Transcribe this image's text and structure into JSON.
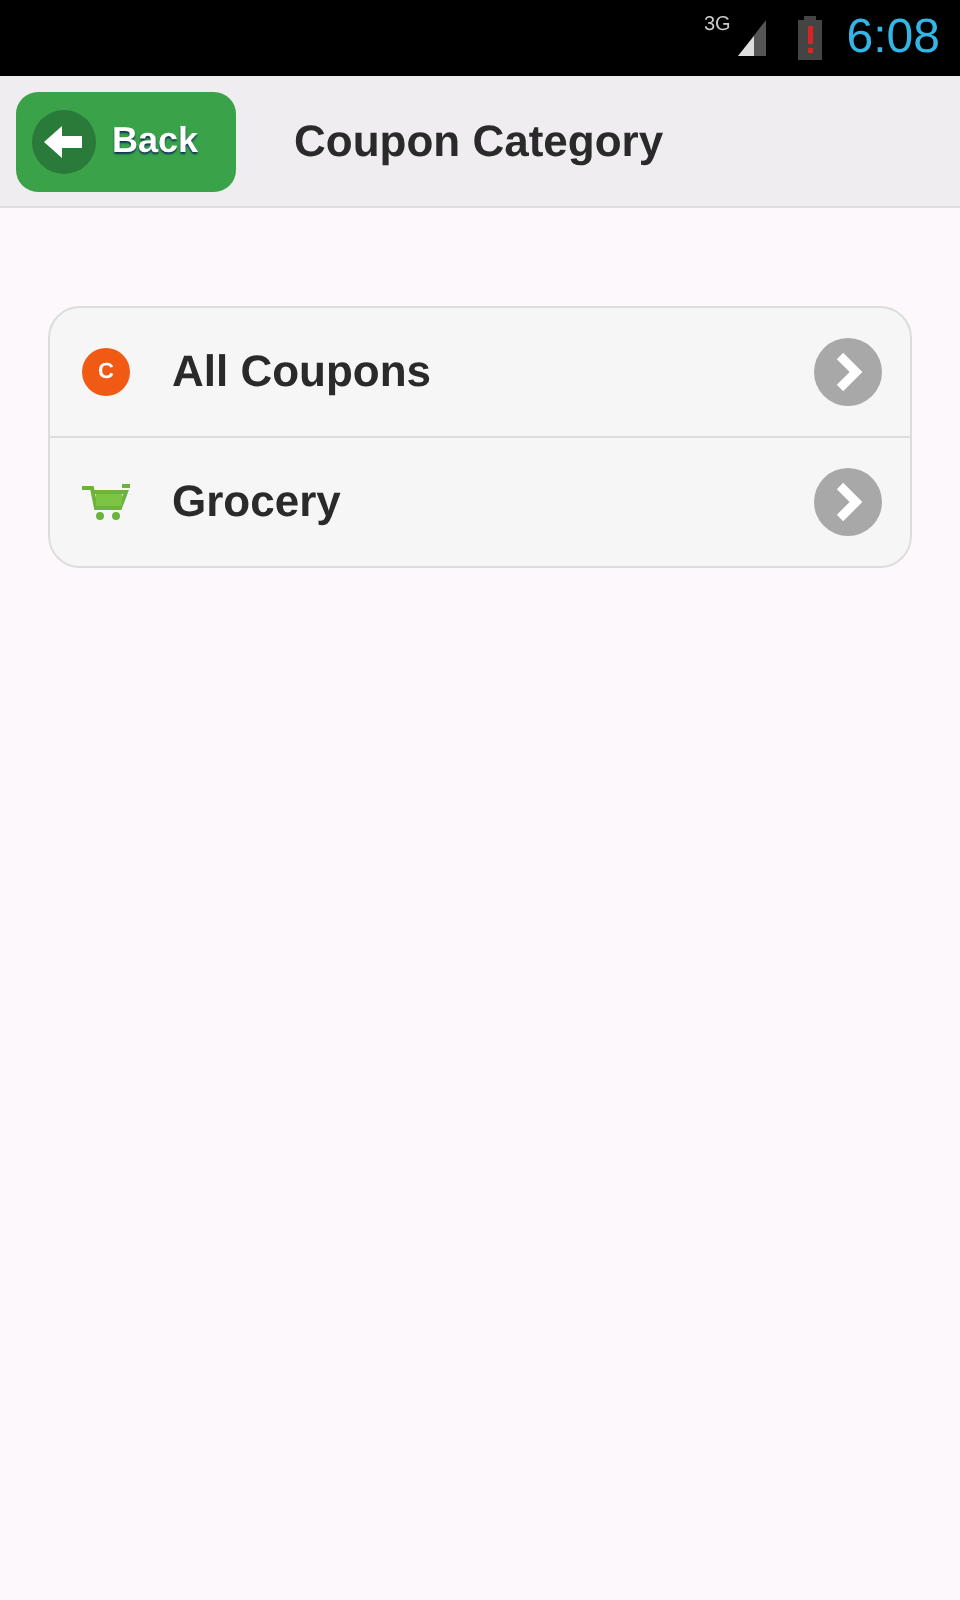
{
  "status_bar": {
    "network": "3G",
    "time": "6:08"
  },
  "header": {
    "back_button": "Back",
    "title": "Coupon Category"
  },
  "categories": [
    {
      "label": "All Coupons",
      "kind": "coupon",
      "icon_text": "C"
    },
    {
      "label": "Grocery",
      "kind": "cart"
    }
  ]
}
